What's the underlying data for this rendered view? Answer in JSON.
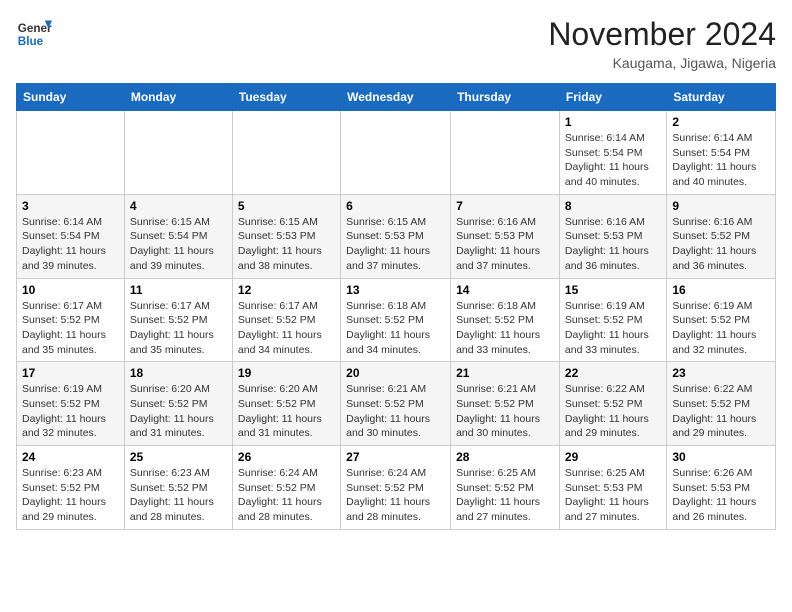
{
  "logo": {
    "line1": "General",
    "line2": "Blue"
  },
  "title": "November 2024",
  "location": "Kaugama, Jigawa, Nigeria",
  "weekdays": [
    "Sunday",
    "Monday",
    "Tuesday",
    "Wednesday",
    "Thursday",
    "Friday",
    "Saturday"
  ],
  "weeks": [
    [
      {
        "day": "",
        "info": ""
      },
      {
        "day": "",
        "info": ""
      },
      {
        "day": "",
        "info": ""
      },
      {
        "day": "",
        "info": ""
      },
      {
        "day": "",
        "info": ""
      },
      {
        "day": "1",
        "info": "Sunrise: 6:14 AM\nSunset: 5:54 PM\nDaylight: 11 hours\nand 40 minutes."
      },
      {
        "day": "2",
        "info": "Sunrise: 6:14 AM\nSunset: 5:54 PM\nDaylight: 11 hours\nand 40 minutes."
      }
    ],
    [
      {
        "day": "3",
        "info": "Sunrise: 6:14 AM\nSunset: 5:54 PM\nDaylight: 11 hours\nand 39 minutes."
      },
      {
        "day": "4",
        "info": "Sunrise: 6:15 AM\nSunset: 5:54 PM\nDaylight: 11 hours\nand 39 minutes."
      },
      {
        "day": "5",
        "info": "Sunrise: 6:15 AM\nSunset: 5:53 PM\nDaylight: 11 hours\nand 38 minutes."
      },
      {
        "day": "6",
        "info": "Sunrise: 6:15 AM\nSunset: 5:53 PM\nDaylight: 11 hours\nand 37 minutes."
      },
      {
        "day": "7",
        "info": "Sunrise: 6:16 AM\nSunset: 5:53 PM\nDaylight: 11 hours\nand 37 minutes."
      },
      {
        "day": "8",
        "info": "Sunrise: 6:16 AM\nSunset: 5:53 PM\nDaylight: 11 hours\nand 36 minutes."
      },
      {
        "day": "9",
        "info": "Sunrise: 6:16 AM\nSunset: 5:52 PM\nDaylight: 11 hours\nand 36 minutes."
      }
    ],
    [
      {
        "day": "10",
        "info": "Sunrise: 6:17 AM\nSunset: 5:52 PM\nDaylight: 11 hours\nand 35 minutes."
      },
      {
        "day": "11",
        "info": "Sunrise: 6:17 AM\nSunset: 5:52 PM\nDaylight: 11 hours\nand 35 minutes."
      },
      {
        "day": "12",
        "info": "Sunrise: 6:17 AM\nSunset: 5:52 PM\nDaylight: 11 hours\nand 34 minutes."
      },
      {
        "day": "13",
        "info": "Sunrise: 6:18 AM\nSunset: 5:52 PM\nDaylight: 11 hours\nand 34 minutes."
      },
      {
        "day": "14",
        "info": "Sunrise: 6:18 AM\nSunset: 5:52 PM\nDaylight: 11 hours\nand 33 minutes."
      },
      {
        "day": "15",
        "info": "Sunrise: 6:19 AM\nSunset: 5:52 PM\nDaylight: 11 hours\nand 33 minutes."
      },
      {
        "day": "16",
        "info": "Sunrise: 6:19 AM\nSunset: 5:52 PM\nDaylight: 11 hours\nand 32 minutes."
      }
    ],
    [
      {
        "day": "17",
        "info": "Sunrise: 6:19 AM\nSunset: 5:52 PM\nDaylight: 11 hours\nand 32 minutes."
      },
      {
        "day": "18",
        "info": "Sunrise: 6:20 AM\nSunset: 5:52 PM\nDaylight: 11 hours\nand 31 minutes."
      },
      {
        "day": "19",
        "info": "Sunrise: 6:20 AM\nSunset: 5:52 PM\nDaylight: 11 hours\nand 31 minutes."
      },
      {
        "day": "20",
        "info": "Sunrise: 6:21 AM\nSunset: 5:52 PM\nDaylight: 11 hours\nand 30 minutes."
      },
      {
        "day": "21",
        "info": "Sunrise: 6:21 AM\nSunset: 5:52 PM\nDaylight: 11 hours\nand 30 minutes."
      },
      {
        "day": "22",
        "info": "Sunrise: 6:22 AM\nSunset: 5:52 PM\nDaylight: 11 hours\nand 29 minutes."
      },
      {
        "day": "23",
        "info": "Sunrise: 6:22 AM\nSunset: 5:52 PM\nDaylight: 11 hours\nand 29 minutes."
      }
    ],
    [
      {
        "day": "24",
        "info": "Sunrise: 6:23 AM\nSunset: 5:52 PM\nDaylight: 11 hours\nand 29 minutes."
      },
      {
        "day": "25",
        "info": "Sunrise: 6:23 AM\nSunset: 5:52 PM\nDaylight: 11 hours\nand 28 minutes."
      },
      {
        "day": "26",
        "info": "Sunrise: 6:24 AM\nSunset: 5:52 PM\nDaylight: 11 hours\nand 28 minutes."
      },
      {
        "day": "27",
        "info": "Sunrise: 6:24 AM\nSunset: 5:52 PM\nDaylight: 11 hours\nand 28 minutes."
      },
      {
        "day": "28",
        "info": "Sunrise: 6:25 AM\nSunset: 5:52 PM\nDaylight: 11 hours\nand 27 minutes."
      },
      {
        "day": "29",
        "info": "Sunrise: 6:25 AM\nSunset: 5:53 PM\nDaylight: 11 hours\nand 27 minutes."
      },
      {
        "day": "30",
        "info": "Sunrise: 6:26 AM\nSunset: 5:53 PM\nDaylight: 11 hours\nand 26 minutes."
      }
    ]
  ]
}
